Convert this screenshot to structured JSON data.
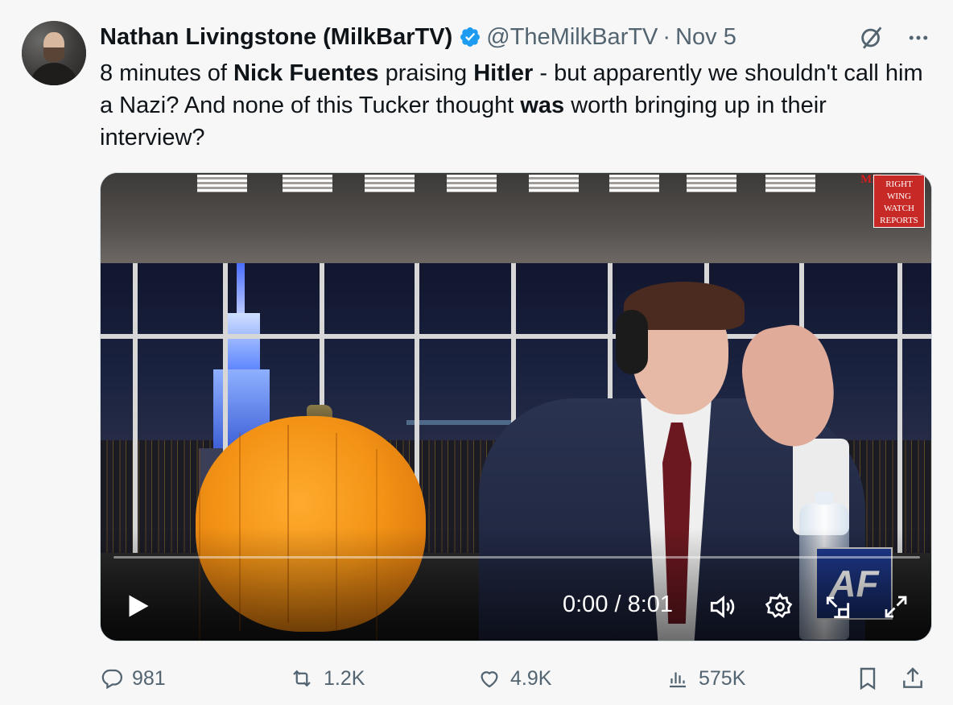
{
  "tweet": {
    "author_name": "Nathan Livingstone (MilkBarTV)",
    "handle": "@TheMilkBarTV",
    "separator": "·",
    "date": "Nov 5",
    "text_parts": {
      "p1": "8 minutes of ",
      "p2": "Nick Fuentes",
      "p3": " praising ",
      "p4": "Hitler",
      "p5": " - but apparently we shouldn't call him a Nazi? And none of this Tucker thought ",
      "p6": "was",
      "p7": " worth bringing up in their interview?"
    }
  },
  "video": {
    "time_display": "0:00 / 8:01",
    "progress_fraction": 0,
    "watermark_lines": [
      "RIGHT",
      "WING",
      "WATCH",
      "REPORTS"
    ],
    "watermark_brand": "MilkBarTV",
    "sign_text": "AF"
  },
  "actions": {
    "replies": "981",
    "reposts": "1.2K",
    "likes": "4.9K",
    "views": "575K"
  },
  "icons": {
    "verified": "verified-badge-icon",
    "grok": "grok-icon",
    "more": "more-icon",
    "play": "play-icon",
    "volume": "volume-icon",
    "settings": "gear-icon",
    "pip": "picture-in-picture-icon",
    "fullscreen": "fullscreen-icon",
    "reply": "reply-icon",
    "repost": "repost-icon",
    "like": "heart-icon",
    "views": "views-icon",
    "bookmark": "bookmark-icon",
    "share": "share-icon"
  },
  "colors": {
    "verified_blue": "#1d9bf0",
    "muted_text": "#536471",
    "watermark_red": "#c72a26"
  }
}
